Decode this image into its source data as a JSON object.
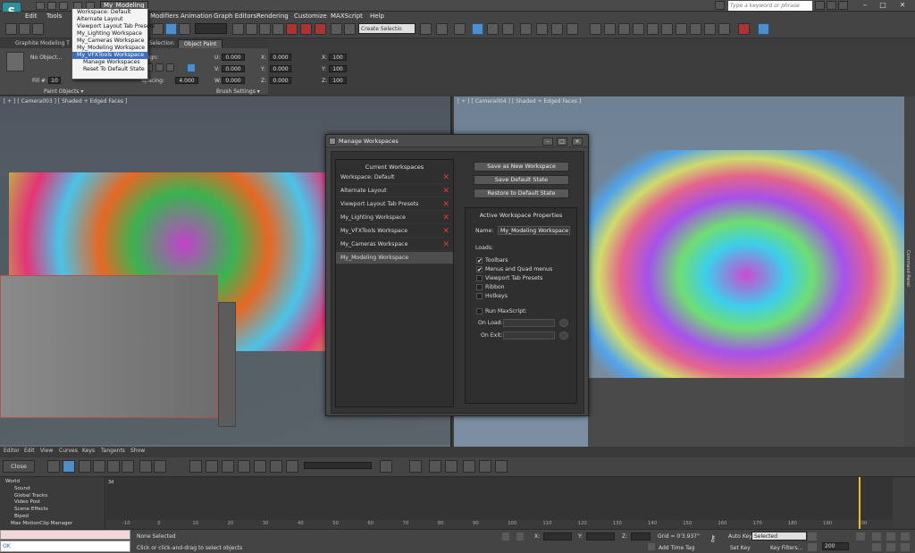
{
  "title_bar": {
    "workspace_dropdown": "My_Modeling V",
    "search_placeholder": "Type a keyword or phrase"
  },
  "menu": {
    "items": [
      "Edit",
      "Tools",
      "Modifiers",
      "Animation",
      "Graph Editors",
      "Rendering",
      "Customize",
      "MAXScript",
      "Help"
    ]
  },
  "workspace_menu": {
    "items": [
      "Workspace: Default",
      "Alternate Layout",
      "Viewport Layout Tab Presets",
      "My_Lighting Workspace",
      "My_Cameras Workspace",
      "My_Modeling Workspace",
      "My_VFXTools Workspace",
      "Manage Workspaces",
      "Reset To Default State"
    ],
    "highlighted": "My_VFXTools Workspace"
  },
  "toolbar": {
    "selection_set": "Create Selectio"
  },
  "ribbon": {
    "tabs": [
      "Graphite Modeling T",
      "Selection",
      "Object Paint"
    ],
    "no_object": "No Object...",
    "align_label": "Align:",
    "fill_label": "Fill #:",
    "fill_value": "10",
    "spacing_label": "Spacing:",
    "spacing_value": "4.000",
    "paint_objects": "Paint Objects ▾",
    "brush_settings": "Brush Settings ▾",
    "u_label": "U:",
    "v_label": "V:",
    "w_label": "W:",
    "x_label": "X:",
    "y_label": "Y:",
    "z_label": "Z:",
    "uv_value": "0.000",
    "scale_value": "100"
  },
  "viewports": {
    "left_label": "[ + ] [ Camera003 ] [ Shaded + Edged Faces ]",
    "right_label": "[ + ] [ Camera004 ] [ Shaded + Edged Faces ]",
    "right_strip": "Command Panel"
  },
  "dialog": {
    "title": "Manage Workspaces",
    "list_header": "Current Workspaces",
    "workspaces": [
      {
        "name": "Workspace: Default",
        "removable": true
      },
      {
        "name": "Alternate Layout",
        "removable": true
      },
      {
        "name": "Viewport Layout Tab Presets",
        "removable": true
      },
      {
        "name": "My_Lighting Workspace",
        "removable": true
      },
      {
        "name": "My_VFXTools Workspace",
        "removable": true
      },
      {
        "name": "My_Cameras Workspace",
        "removable": true
      },
      {
        "name": "My_Modeling Workspace",
        "removable": false
      }
    ],
    "remove_glyph": "✕",
    "buttons": {
      "save_new": "Save as New Workspace",
      "save_default": "Save Default State",
      "restore_default": "Restore to Default State"
    },
    "props_header": "Active Workspace Properties",
    "name_label": "Name:",
    "name_value": "My_Modeling Workspace",
    "loads_label": "Loads:",
    "loads": [
      {
        "label": "Toolbars",
        "checked": true
      },
      {
        "label": "Menus and Quad menus",
        "checked": true
      },
      {
        "label": "Viewport Tab Presets",
        "checked": false
      },
      {
        "label": "Ribbon",
        "checked": false
      },
      {
        "label": "Hotkeys",
        "checked": false
      }
    ],
    "check_glyph": "✔",
    "run_maxscript": "Run MaxScript:",
    "on_load": "On Load:",
    "on_exit": "On Exit:"
  },
  "trackview": {
    "menu": [
      "Editor",
      "Edit",
      "View",
      "Curves",
      "Keys",
      "Tangents",
      "Show"
    ],
    "close_label": "Close",
    "tree": [
      "World",
      "Sound",
      "Global Tracks",
      "Video Post",
      "Scene Effects",
      "Biped",
      "Max MotionClip Manager"
    ],
    "ruler": [
      "-10",
      "0",
      "10",
      "20",
      "30",
      "40",
      "50",
      "60",
      "70",
      "80",
      "90",
      "100",
      "110",
      "120",
      "130",
      "140",
      "150",
      "160",
      "170",
      "180",
      "190",
      "200"
    ]
  },
  "status": {
    "maxscript_output": "OK",
    "selected": "None Selected",
    "prompt": "Click or click-and-drag to select objects",
    "x_label": "X:",
    "y_label": "Y:",
    "z_label": "Z:",
    "grid": "Grid = 0'3.937\"",
    "add_time_tag": "Add Time Tag",
    "auto_key": "Auto Key",
    "set_key": "Set Key",
    "selected_dropdown": "Selected",
    "key_filters": "Key Filters...",
    "frame": "200"
  },
  "colors": {
    "accent": "#3c6fc0",
    "remove": "#e03a3a",
    "time_slider": "#e5c42b"
  }
}
